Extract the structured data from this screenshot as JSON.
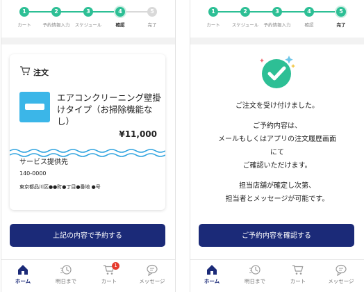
{
  "screen1": {
    "stepper": {
      "steps": [
        {
          "num": "1",
          "label": "カート",
          "state": "done"
        },
        {
          "num": "2",
          "label": "予約情報入力",
          "state": "done"
        },
        {
          "num": "3",
          "label": "スケジュール",
          "state": "done"
        },
        {
          "num": "4",
          "label": "確認",
          "state": "current"
        },
        {
          "num": "5",
          "label": "完了",
          "state": "todo"
        }
      ]
    },
    "order_card": {
      "title": "注文",
      "product_name": "エアコンクリーニング壁掛けタイプ（お掃除機能なし）",
      "price": "¥11,000",
      "service_title": "サービス提供先",
      "zip": "140-0000",
      "address": "東京都品川区●●町●丁目●番地 ●号"
    },
    "submit_label": "上記の内容で予約する"
  },
  "screen2": {
    "stepper": {
      "steps": [
        {
          "num": "1",
          "label": "カート",
          "state": "done"
        },
        {
          "num": "2",
          "label": "スケジュール",
          "state": "done"
        },
        {
          "num": "3",
          "label": "予約情報入力",
          "state": "done"
        },
        {
          "num": "4",
          "label": "確認",
          "state": "done"
        },
        {
          "num": "5",
          "label": "完了",
          "state": "current"
        }
      ]
    },
    "message_lines": [
      "ご注文を受け付けました。",
      "ご予約内容は、",
      "メールもしくはアプリの注文履歴画面",
      "にて",
      "ご確認いただけます。",
      "担当店舗が確定し次第、",
      "担当者とメッセージが可能です。"
    ],
    "confirm_label": "ご予約内容を確認する"
  },
  "tabbar": {
    "tabs": [
      {
        "label": "ホーム",
        "icon": "home-icon"
      },
      {
        "label": "明日まで",
        "icon": "clock-speed-icon"
      },
      {
        "label": "カート",
        "icon": "cart-icon"
      },
      {
        "label": "メッセージ",
        "icon": "chat-icon"
      }
    ],
    "cart_badge": "1"
  },
  "colors": {
    "accent": "#2dbf95",
    "navy": "#1b2a78",
    "inactive": "#d9d9d9",
    "badge": "#e63b2e",
    "thumb": "#3bb6e8"
  }
}
